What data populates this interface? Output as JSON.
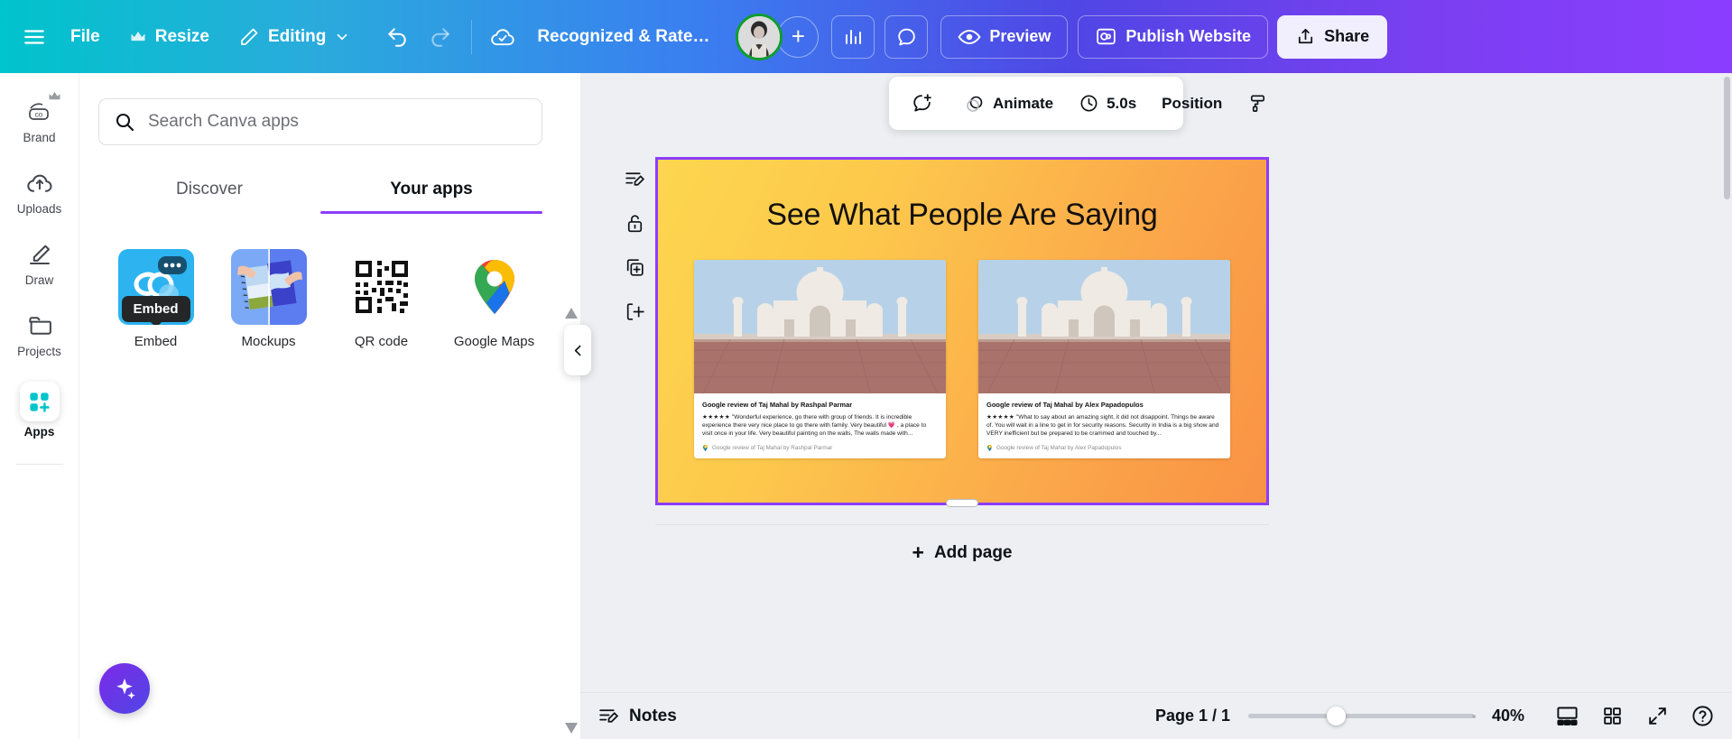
{
  "topbar": {
    "menu_icon": "hamburger-icon",
    "file_label": "File",
    "resize_label": "Resize",
    "editing_label": "Editing",
    "undo_icon": "undo-icon",
    "redo_icon": "redo-icon",
    "cloud_saved_icon": "cloud-check-icon",
    "doc_title": "Recognized & Rated ...",
    "add_collaborator_label": "+",
    "insights_icon": "bar-chart-icon",
    "comments_icon": "comment-icon",
    "preview_label": "Preview",
    "publish_label": "Publish Website",
    "share_label": "Share"
  },
  "rail": {
    "items": [
      {
        "label": "Brand",
        "icon": "brand-icon",
        "pro": true,
        "active": false
      },
      {
        "label": "Uploads",
        "icon": "cloud-upload-icon",
        "pro": false,
        "active": false
      },
      {
        "label": "Draw",
        "icon": "pen-draw-icon",
        "pro": false,
        "active": false
      },
      {
        "label": "Projects",
        "icon": "folder-icon",
        "pro": false,
        "active": false
      },
      {
        "label": "Apps",
        "icon": "apps-grid-icon",
        "pro": false,
        "active": true
      }
    ]
  },
  "panel": {
    "search": {
      "placeholder": "Search Canva apps",
      "value": "",
      "icon": "search-icon"
    },
    "tabs": [
      {
        "label": "Discover",
        "active": false
      },
      {
        "label": "Your apps",
        "active": true
      }
    ],
    "tooltip": "Embed",
    "apps": [
      {
        "label": "Embed",
        "icon": "embed-app-icon"
      },
      {
        "label": "Mockups",
        "icon": "mockups-app-icon"
      },
      {
        "label": "QR code",
        "icon": "qr-code-app-icon"
      },
      {
        "label": "Google Maps",
        "icon": "google-maps-app-icon"
      }
    ],
    "collapse_icon": "chevron-left-icon",
    "magic_icon": "sparkle-icon",
    "scroll_up_icon": "caret-up-icon",
    "scroll_down_icon": "caret-down-icon"
  },
  "object_toolbar": {
    "comment_icon": "add-comment-icon",
    "color_swatch": "#fcb849",
    "animate_label": "Animate",
    "animate_icon": "animate-icon",
    "duration_label": "5.0s",
    "timer_icon": "clock-icon",
    "position_label": "Position",
    "paint_roller_icon": "paint-roller-icon"
  },
  "page_tools": [
    {
      "icon": "notes-edit-icon"
    },
    {
      "icon": "lock-icon"
    },
    {
      "icon": "duplicate-page-icon"
    },
    {
      "icon": "add-page-icon"
    }
  ],
  "canvas": {
    "heading": "See What People Are Saying",
    "bg_start": "#fdd64f",
    "bg_end": "#f99245",
    "border_color": "#8b3dff",
    "cards": [
      {
        "title": "Google review of Taj Mahal by Rashpal Parmar",
        "stars": "★★★★★",
        "body": "\"Wonderful experience, go there with group of friends. It is incredible experience there very nice place to go there with family. Very beautiful 💗 , a place to visit once in your life. Very beautiful painting on the walls, The walls made with...",
        "source": "Google review of Taj Mahal by Rashpal Parmar",
        "source_icon": "google-maps-pin-icon",
        "image_alt": "taj-mahal-photo"
      },
      {
        "title": "Google review of Taj Mahal by Alex Papadopulos",
        "stars": "★★★★★",
        "body": "\"What to say about an amazing sight, it did not disappoint. Things be aware of. You will wait in a line to get in for security reasons. Security in India is a big show and VERY inefficient but be prepared to be crammed and touched by...",
        "source": "Google review of Taj Mahal by Alex Papadopulos",
        "source_icon": "google-maps-pin-icon",
        "image_alt": "taj-mahal-photo"
      }
    ]
  },
  "add_page": {
    "label": "Add page",
    "plus": "+"
  },
  "bottombar": {
    "notes_label": "Notes",
    "notes_icon": "notes-icon",
    "page_indicator": "Page 1 / 1",
    "zoom_value": "40%",
    "grid_view_icon": "page-layout-icon",
    "thumbnails_icon": "grid-view-icon",
    "fullscreen_icon": "expand-icon",
    "help_icon": "help-icon"
  }
}
